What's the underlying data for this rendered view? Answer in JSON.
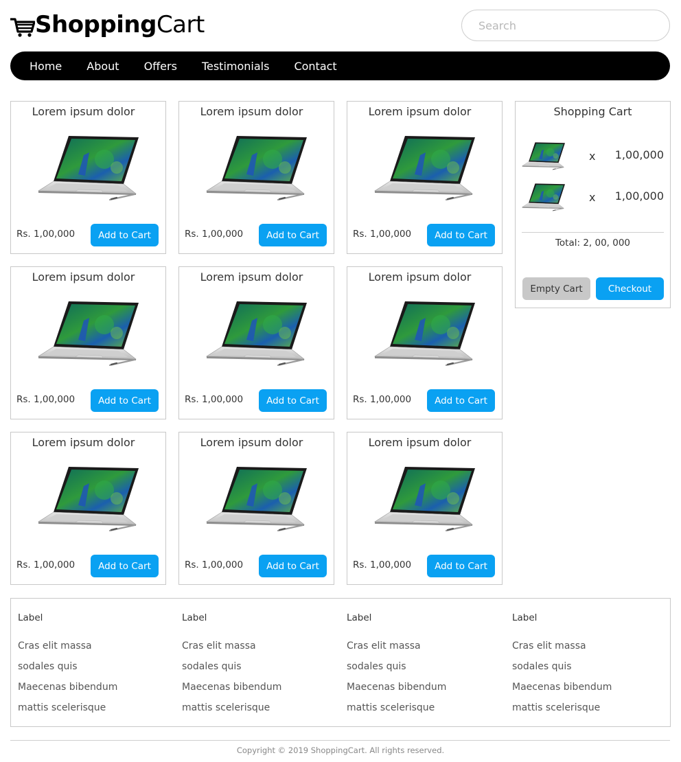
{
  "header": {
    "logo_bold": "Shopping",
    "logo_light": "Cart",
    "logo_icon": "shopping-cart-icon",
    "search_placeholder": "Search"
  },
  "nav": {
    "items": [
      {
        "label": "Home"
      },
      {
        "label": "About"
      },
      {
        "label": "Offers"
      },
      {
        "label": "Testimonials"
      },
      {
        "label": "Contact"
      }
    ]
  },
  "products": [
    {
      "title": "Lorem ipsum dolor",
      "price": "Rs. 1,00,000",
      "button": "Add to Cart",
      "image": "laptop-image"
    },
    {
      "title": "Lorem ipsum dolor",
      "price": "Rs. 1,00,000",
      "button": "Add to Cart",
      "image": "laptop-image"
    },
    {
      "title": "Lorem ipsum dolor",
      "price": "Rs. 1,00,000",
      "button": "Add to Cart",
      "image": "laptop-image"
    },
    {
      "title": "Lorem ipsum dolor",
      "price": "Rs. 1,00,000",
      "button": "Add to Cart",
      "image": "laptop-image"
    },
    {
      "title": "Lorem ipsum dolor",
      "price": "Rs. 1,00,000",
      "button": "Add to Cart",
      "image": "laptop-image"
    },
    {
      "title": "Lorem ipsum dolor",
      "price": "Rs. 1,00,000",
      "button": "Add to Cart",
      "image": "laptop-image"
    },
    {
      "title": "Lorem ipsum dolor",
      "price": "Rs. 1,00,000",
      "button": "Add to Cart",
      "image": "laptop-image"
    },
    {
      "title": "Lorem ipsum dolor",
      "price": "Rs. 1,00,000",
      "button": "Add to Cart",
      "image": "laptop-image"
    },
    {
      "title": "Lorem ipsum dolor",
      "price": "Rs. 1,00,000",
      "button": "Add to Cart",
      "image": "laptop-image"
    }
  ],
  "cart": {
    "title": "Shopping Cart",
    "items": [
      {
        "qty_symbol": "x",
        "amount": "1,00,000"
      },
      {
        "qty_symbol": "x",
        "amount": "1,00,000"
      }
    ],
    "total": "Total: 2, 00, 000",
    "empty_label": "Empty Cart",
    "checkout_label": "Checkout"
  },
  "footer": {
    "columns": [
      {
        "label": "Label",
        "links": [
          "Cras elit massa",
          "sodales quis",
          "Maecenas bibendum",
          "mattis scelerisque"
        ]
      },
      {
        "label": "Label",
        "links": [
          "Cras elit massa",
          "sodales quis",
          "Maecenas bibendum",
          "mattis scelerisque"
        ]
      },
      {
        "label": "Label",
        "links": [
          "Cras elit massa",
          "sodales quis",
          "Maecenas bibendum",
          "mattis scelerisque"
        ]
      },
      {
        "label": "Label",
        "links": [
          "Cras elit massa",
          "sodales quis",
          "Maecenas bibendum",
          "mattis scelerisque"
        ]
      }
    ],
    "copyright": "Copyright © 2019 ShoppingCart. All rights reserved."
  },
  "colors": {
    "accent": "#0aa1f2",
    "nav_bg": "#000000",
    "muted_button": "#c8c8c8",
    "border": "#c8c8c8"
  }
}
